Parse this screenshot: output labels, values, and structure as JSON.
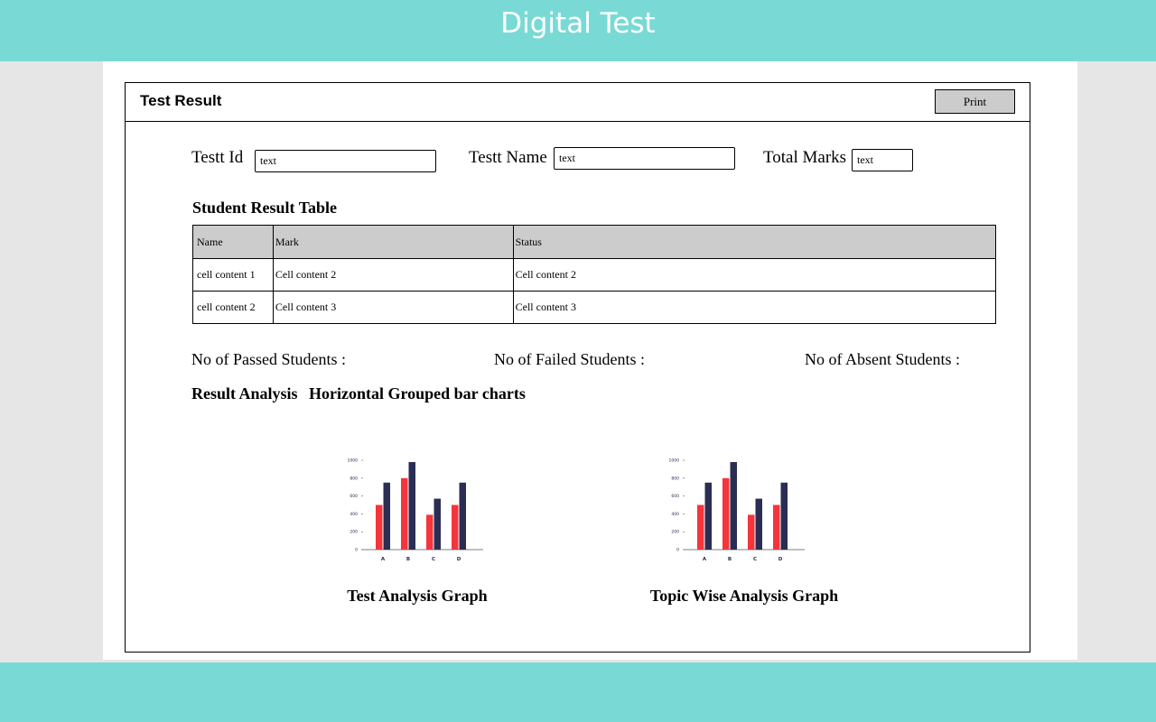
{
  "app": {
    "title": "Digital Test"
  },
  "panel": {
    "title": "Test Result",
    "print_label": "Print"
  },
  "fields": {
    "test_id": {
      "label": "Testt Id",
      "value": "text"
    },
    "test_name": {
      "label": "Testt Name",
      "value": "text"
    },
    "total_marks": {
      "label": "Total Marks",
      "value": "text"
    }
  },
  "result_table": {
    "title": "Student Result Table",
    "columns": [
      "Name",
      "Mark",
      "Status"
    ],
    "rows": [
      [
        "cell content 1",
        "Cell content 2",
        "Cell content 2"
      ],
      [
        "cell content 2",
        "Cell content 3",
        "Cell content 3"
      ]
    ]
  },
  "stats": {
    "passed": "No of Passed Students :",
    "failed": "No of Failed Students :",
    "absent": "No of Absent Students :"
  },
  "analysis": {
    "title": "Result Analysis",
    "subtitle": "Horizontal Grouped bar charts"
  },
  "colors": {
    "series_a": "#f4353b",
    "series_b": "#2a2d54",
    "accent": "#79dad5"
  },
  "chart_data": [
    {
      "type": "bar",
      "title": "Test Analysis Graph",
      "categories": [
        "A",
        "B",
        "C",
        "D"
      ],
      "series": [
        {
          "values": [
            500,
            800,
            390,
            500
          ]
        },
        {
          "values": [
            750,
            980,
            570,
            750
          ]
        }
      ],
      "yticks": [
        0,
        200,
        400,
        600,
        800,
        1000
      ],
      "ylim": [
        0,
        1000
      ]
    },
    {
      "type": "bar",
      "title": "Topic Wise Analysis Graph",
      "categories": [
        "A",
        "B",
        "C",
        "D"
      ],
      "series": [
        {
          "values": [
            500,
            800,
            390,
            500
          ]
        },
        {
          "values": [
            750,
            980,
            570,
            750
          ]
        }
      ],
      "yticks": [
        0,
        200,
        400,
        600,
        800,
        1000
      ],
      "ylim": [
        0,
        1000
      ]
    }
  ]
}
